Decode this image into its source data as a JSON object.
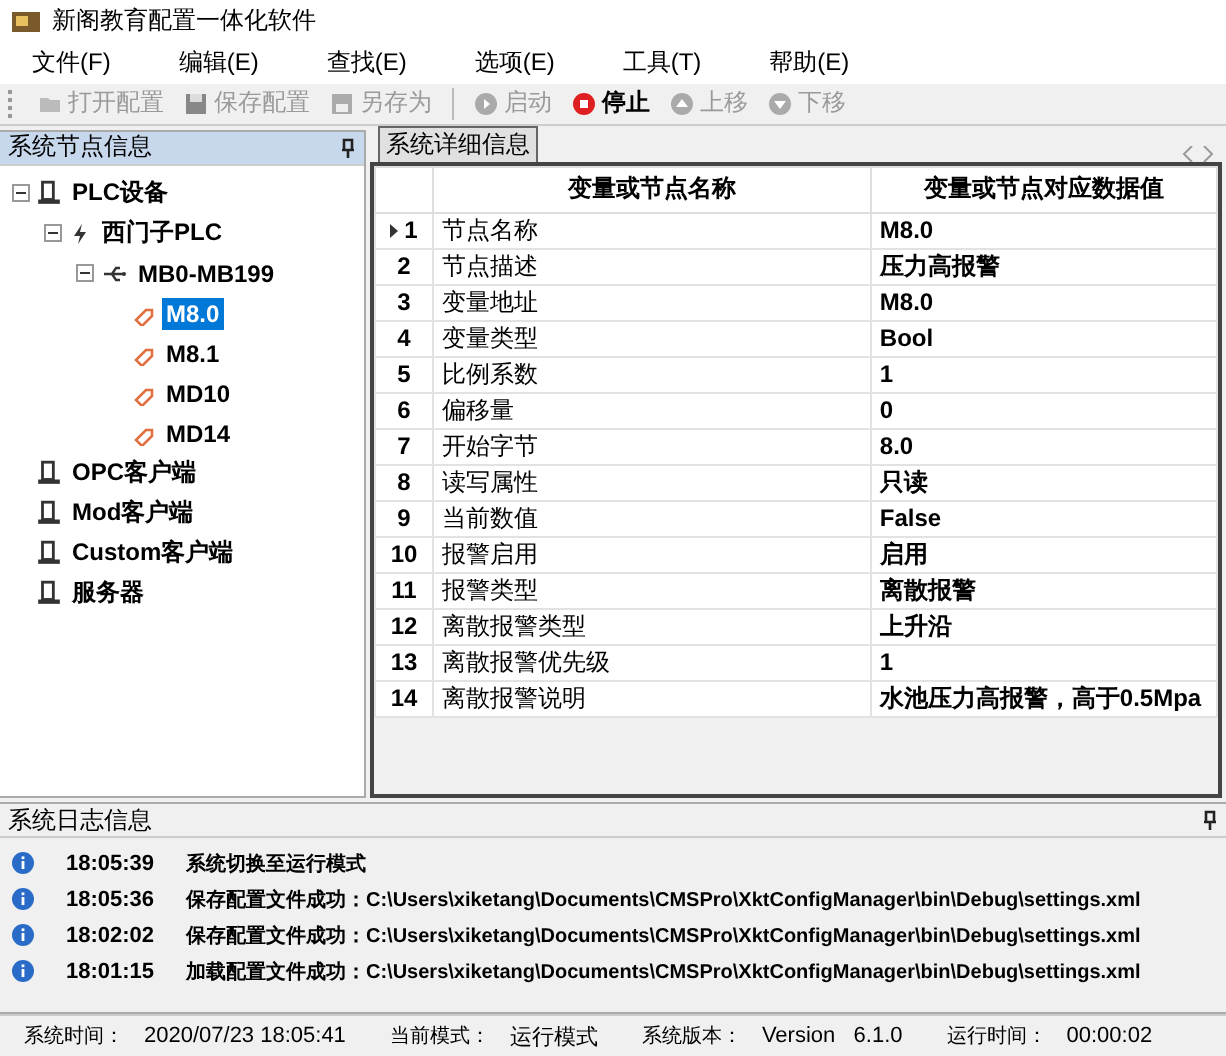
{
  "window": {
    "title": "新阁教育配置一体化软件"
  },
  "menu": [
    "文件(F)",
    "编辑(E)",
    "查找(E)",
    "选项(E)",
    "工具(T)",
    "帮助(E)"
  ],
  "toolbar": [
    {
      "kind": "open",
      "label": "打开配置",
      "disabled": true
    },
    {
      "kind": "save",
      "label": "保存配置",
      "disabled": true
    },
    {
      "kind": "saveas",
      "label": "另存为",
      "disabled": true
    },
    {
      "kind": "start",
      "label": "启动",
      "disabled": true
    },
    {
      "kind": "stop",
      "label": "停止",
      "disabled": false
    },
    {
      "kind": "up",
      "label": "上移",
      "disabled": true
    },
    {
      "kind": "down",
      "label": "下移",
      "disabled": true
    }
  ],
  "node_panel": {
    "title": "系统节点信息",
    "tree": [
      {
        "kind": "device",
        "label": "PLC设备",
        "expanded": true,
        "selected": false,
        "children": [
          {
            "kind": "plc",
            "label": "西门子PLC",
            "expanded": true,
            "selected": false,
            "children": [
              {
                "kind": "group",
                "label": "MB0-MB199",
                "expanded": true,
                "selected": false,
                "children": [
                  {
                    "kind": "tag",
                    "label": "M8.0",
                    "selected": true
                  },
                  {
                    "kind": "tag",
                    "label": "M8.1",
                    "selected": false
                  },
                  {
                    "kind": "tag",
                    "label": "MD10",
                    "selected": false
                  },
                  {
                    "kind": "tag",
                    "label": "MD14",
                    "selected": false
                  }
                ]
              }
            ]
          }
        ]
      },
      {
        "kind": "device",
        "label": "OPC客户端",
        "selected": false
      },
      {
        "kind": "device",
        "label": "Mod客户端",
        "selected": false
      },
      {
        "kind": "device",
        "label": "Custom客户端",
        "selected": false
      },
      {
        "kind": "device",
        "label": "服务器",
        "selected": false
      }
    ]
  },
  "detail_panel": {
    "tab": "系统详细信息",
    "columns": [
      "变量或节点名称",
      "变量或节点对应数据值"
    ],
    "rows": [
      {
        "index": "1",
        "name": "节点名称",
        "value": "M8.0",
        "selected": true
      },
      {
        "index": "2",
        "name": "节点描述",
        "value": "压力高报警",
        "selected": false
      },
      {
        "index": "3",
        "name": "变量地址",
        "value": "M8.0",
        "selected": false
      },
      {
        "index": "4",
        "name": "变量类型",
        "value": "Bool",
        "selected": false
      },
      {
        "index": "5",
        "name": "比例系数",
        "value": "1",
        "selected": false
      },
      {
        "index": "6",
        "name": "偏移量",
        "value": "0",
        "selected": false
      },
      {
        "index": "7",
        "name": "开始字节",
        "value": "8.0",
        "selected": false
      },
      {
        "index": "8",
        "name": "读写属性",
        "value": "只读",
        "selected": false
      },
      {
        "index": "9",
        "name": "当前数值",
        "value": "False",
        "selected": false
      },
      {
        "index": "10",
        "name": "报警启用",
        "value": "启用",
        "selected": false
      },
      {
        "index": "11",
        "name": "报警类型",
        "value": "离散报警",
        "selected": false
      },
      {
        "index": "12",
        "name": "离散报警类型",
        "value": "上升沿",
        "selected": false
      },
      {
        "index": "13",
        "name": "离散报警优先级",
        "value": "1",
        "selected": false
      },
      {
        "index": "14",
        "name": "离散报警说明",
        "value": "水池压力高报警，高于0.5Mpa",
        "selected": false
      }
    ]
  },
  "log_panel": {
    "title": "系统日志信息",
    "entries": [
      {
        "time": "18:05:39",
        "message": "系统切换至运行模式"
      },
      {
        "time": "18:05:36",
        "message": "保存配置文件成功：C:\\Users\\xiketang\\Documents\\CMSPro\\XktConfigManager\\bin\\Debug\\settings.xml"
      },
      {
        "time": "18:02:02",
        "message": "保存配置文件成功：C:\\Users\\xiketang\\Documents\\CMSPro\\XktConfigManager\\bin\\Debug\\settings.xml"
      },
      {
        "time": "18:01:15",
        "message": "加载配置文件成功：C:\\Users\\xiketang\\Documents\\CMSPro\\XktConfigManager\\bin\\Debug\\settings.xml"
      }
    ]
  },
  "status_bar": [
    {
      "label": "系统时间：",
      "value": "2020/07/23 18:05:41"
    },
    {
      "label": "当前模式：",
      "value": "运行模式"
    },
    {
      "label": "系统版本：",
      "value": "Version   6.1.0"
    },
    {
      "label": "运行时间：",
      "value": "00:00:02"
    }
  ]
}
